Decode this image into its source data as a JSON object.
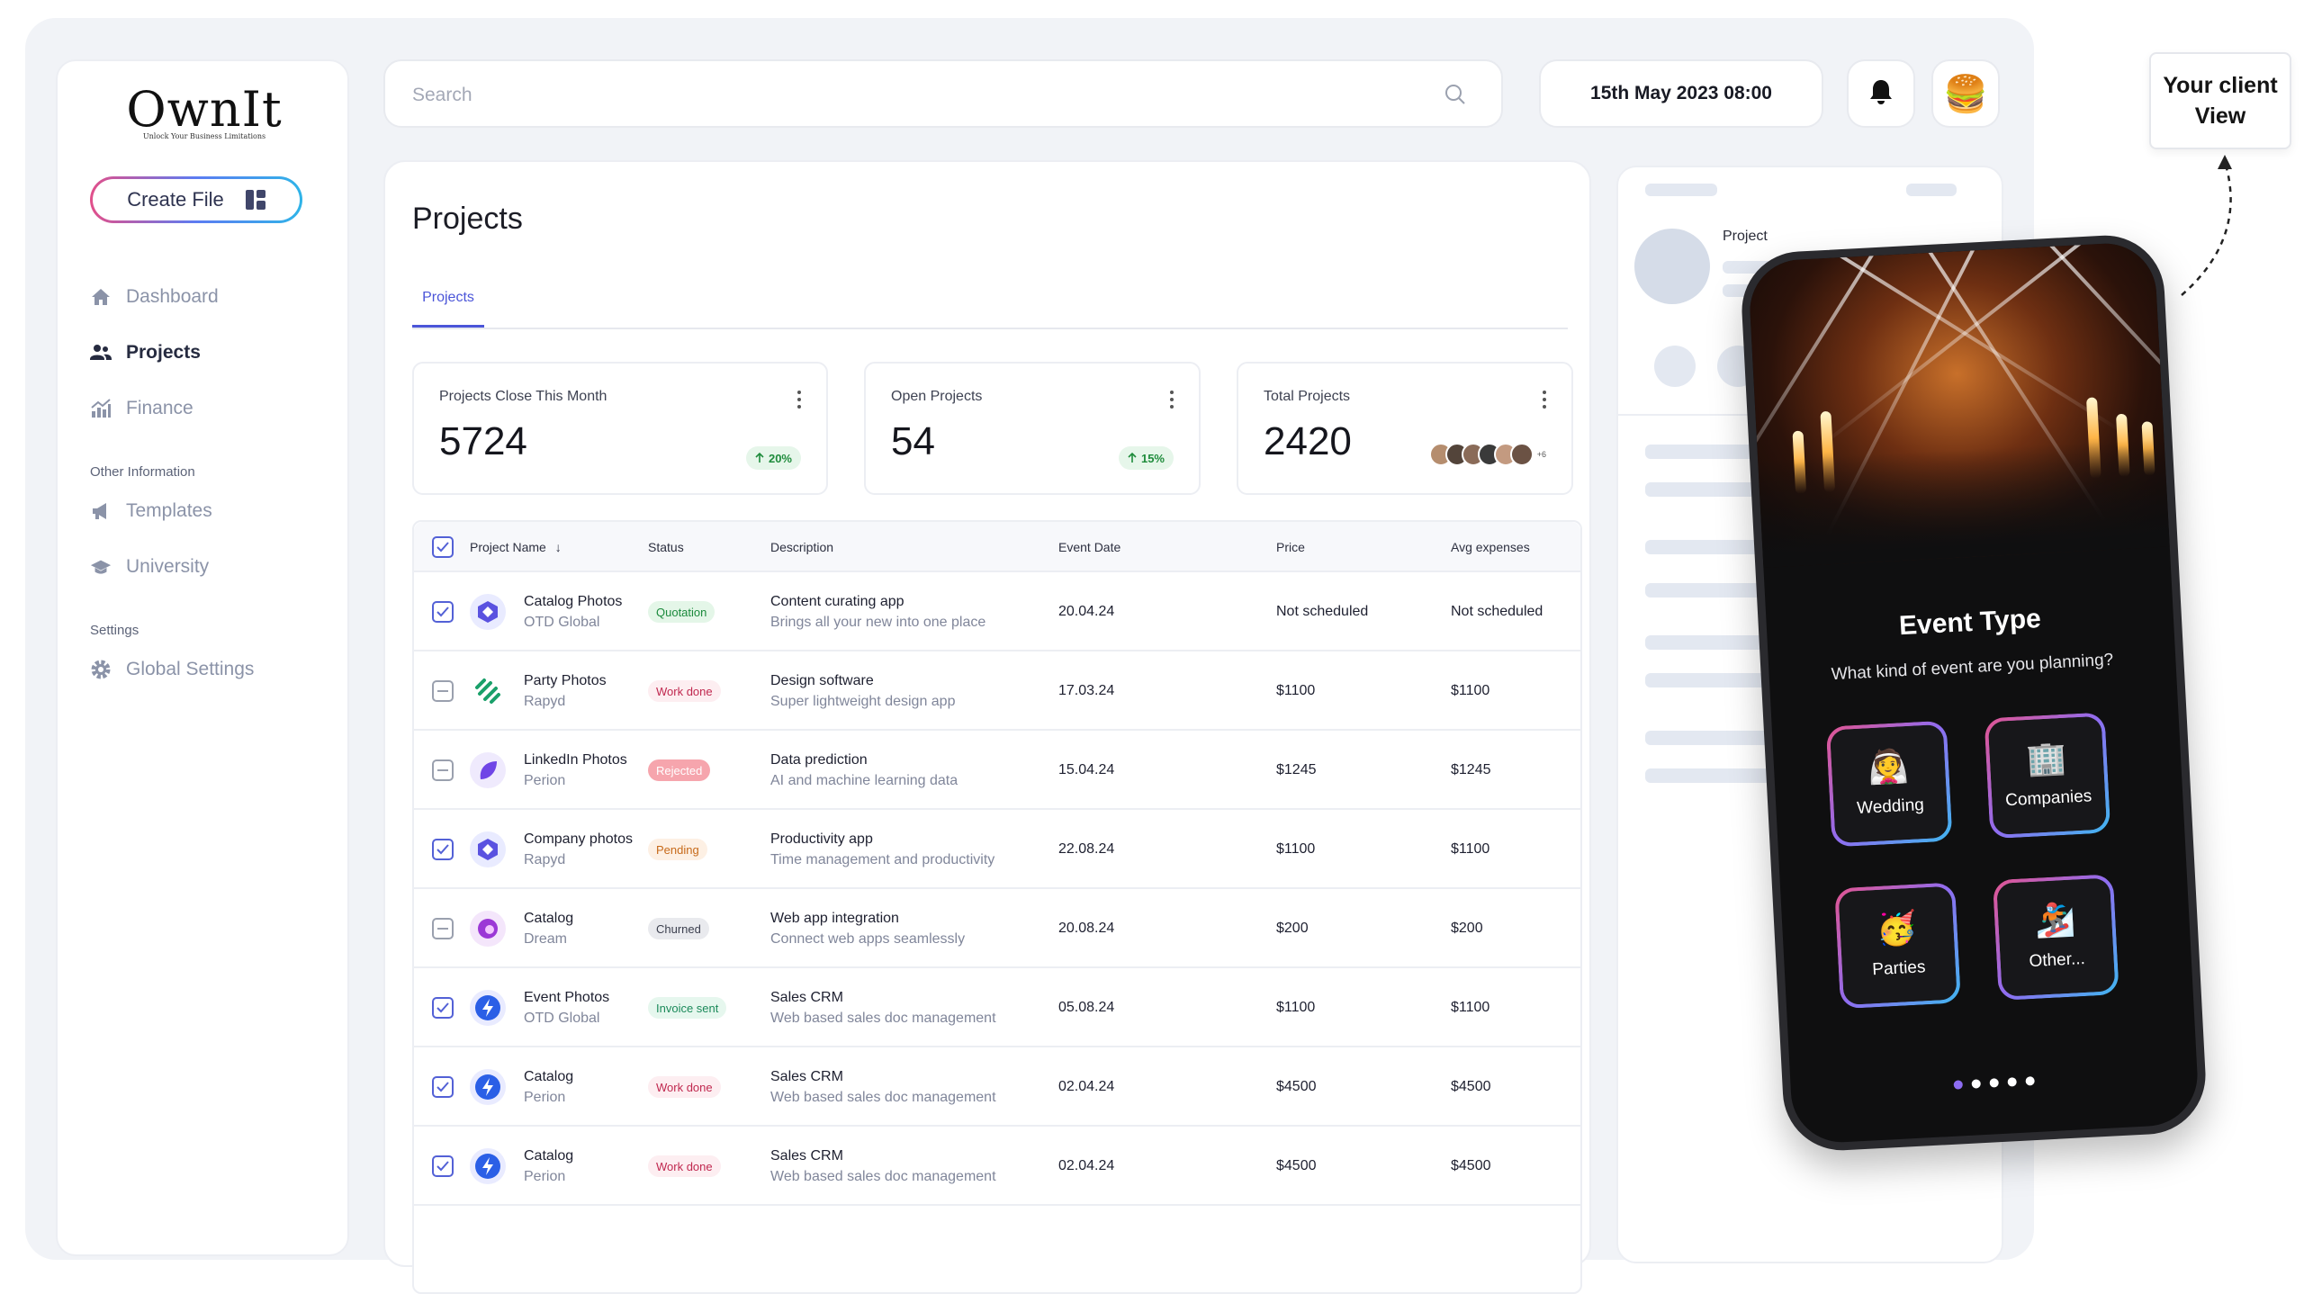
{
  "brand": {
    "name": "OwnIt",
    "tagline": "Unlock Your Business Limitations"
  },
  "sidebar": {
    "create_button": "Create File",
    "nav": [
      {
        "label": "Dashboard",
        "icon": "home-icon"
      },
      {
        "label": "Projects",
        "icon": "users-icon",
        "active": true
      },
      {
        "label": "Finance",
        "icon": "chart-icon"
      }
    ],
    "other_section": "Other Information",
    "other": [
      {
        "label": "Templates",
        "icon": "megaphone-icon"
      },
      {
        "label": "University",
        "icon": "graduation-cap-icon"
      }
    ],
    "settings_section": "Settings",
    "settings": [
      {
        "label": "Global Settings",
        "icon": "gear-icon"
      }
    ]
  },
  "topbar": {
    "search_placeholder": "Search",
    "datetime": "15th May 2023 08:00"
  },
  "main": {
    "title": "Projects",
    "tab": "Projects",
    "stats": [
      {
        "label": "Projects Close This Month",
        "value": "5724",
        "change": "20%"
      },
      {
        "label": "Open Projects",
        "value": "54",
        "change": "15%"
      },
      {
        "label": "Total Projects",
        "value": "2420",
        "extra": "+6"
      }
    ],
    "table": {
      "columns": [
        "Project Name",
        "Status",
        "Description",
        "Event Date",
        "Price",
        "Avg expenses"
      ],
      "rows": [
        {
          "checked": true,
          "name": "Catalog Photos",
          "org": "OTD Global",
          "status": "Quotation",
          "desc": "Content curating app",
          "desc2": "Brings all your new into one place",
          "date": "20.04.24",
          "price": "Not scheduled",
          "avg": "Not scheduled",
          "status_bg": "#e4f6e8",
          "status_fg": "#1b8a3c",
          "logo_color": "#5a52e0",
          "logo": "hexagon"
        },
        {
          "checked": false,
          "name": "Party Photos",
          "org": "Rapyd",
          "status": "Work done",
          "desc": "Design software",
          "desc2": "Super lightweight design app",
          "date": "17.03.24",
          "price": "$1100",
          "avg": "$1100",
          "status_bg": "#fdeef1",
          "status_fg": "#c0284f",
          "logo_color": "#1aa06a",
          "logo": "stripes"
        },
        {
          "checked": false,
          "name": "LinkedIn Photos",
          "org": "Perion",
          "status": "Rejected",
          "desc": "Data prediction",
          "desc2": "AI and machine learning data",
          "date": "15.04.24",
          "price": "$1245",
          "avg": "$1245",
          "status_bg": "#f6a5ad",
          "status_fg": "#ffffff",
          "logo_color": "#6f45e6",
          "logo": "leaf"
        },
        {
          "checked": true,
          "name": "Company photos",
          "org": "Rapyd",
          "status": "Pending",
          "desc": "Productivity app",
          "desc2": "Time management and productivity",
          "date": "22.08.24",
          "price": "$1100",
          "avg": "$1100",
          "status_bg": "#fdf0e4",
          "status_fg": "#c76a1a",
          "logo_color": "#5a52e0",
          "logo": "hexagon"
        },
        {
          "checked": false,
          "name": "Catalog",
          "org": "Dream",
          "status": "Churned",
          "desc": "Web app integration",
          "desc2": "Connect web apps seamlessly",
          "date": "20.08.24",
          "price": "$200",
          "avg": "$200",
          "status_bg": "#e9eaee",
          "status_fg": "#3b3f4e",
          "logo_color": "#9b38d6",
          "logo": "ring"
        },
        {
          "checked": true,
          "name": "Event Photos",
          "org": "OTD Global",
          "status": "Invoice sent",
          "desc": "Sales CRM",
          "desc2": "Web based sales doc management",
          "date": "05.08.24",
          "price": "$1100",
          "avg": "$1100",
          "status_bg": "#e6f7ee",
          "status_fg": "#1b8a5a",
          "logo_color": "#2b5fe6",
          "logo": "bolt"
        },
        {
          "checked": true,
          "name": "Catalog",
          "org": "Perion",
          "status": "Work done",
          "desc": "Sales CRM",
          "desc2": "Web based sales doc management",
          "date": "02.04.24",
          "price": "$4500",
          "avg": "$4500",
          "status_bg": "#fdeef1",
          "status_fg": "#c0284f",
          "logo_color": "#2b5fe6",
          "logo": "bolt"
        },
        {
          "checked": true,
          "name": "Catalog",
          "org": "Perion",
          "status": "Work done",
          "desc": "Sales CRM",
          "desc2": "Web based sales doc management",
          "date": "02.04.24",
          "price": "$4500",
          "avg": "$4500",
          "status_bg": "#fdeef1",
          "status_fg": "#c0284f",
          "logo_color": "#2b5fe6",
          "logo": "bolt"
        }
      ]
    }
  },
  "preview": {
    "label": "Project"
  },
  "phone": {
    "title": "Event Type",
    "subtitle": "What kind of event are you planning?",
    "options": [
      {
        "label": "Wedding",
        "emoji": "👰"
      },
      {
        "label": "Companies",
        "emoji": "🏢"
      },
      {
        "label": "Parties",
        "emoji": "🥳"
      },
      {
        "label": "Other...",
        "emoji": "🏂"
      }
    ]
  },
  "callout": {
    "line1": "Your client",
    "line2": "View"
  }
}
